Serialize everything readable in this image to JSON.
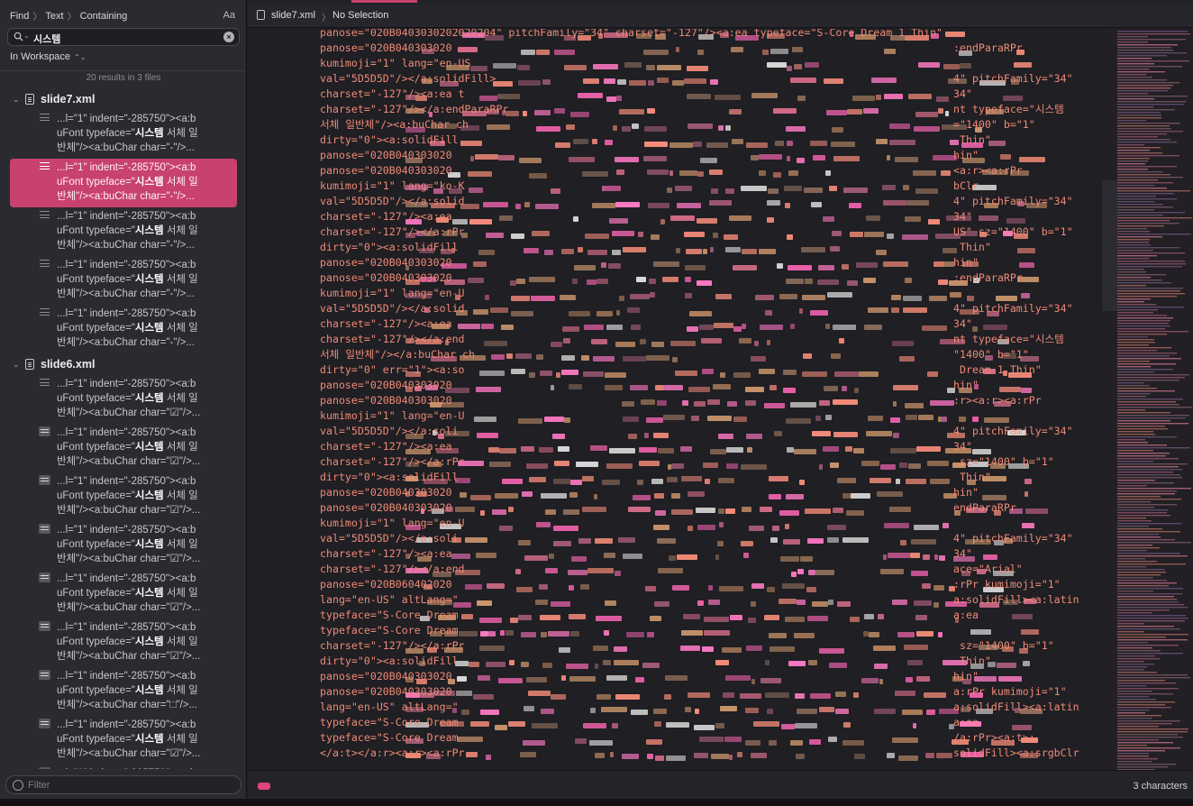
{
  "find": {
    "breadcrumb": [
      "Find",
      "Text",
      "Containing"
    ],
    "case_toggle": "Aa",
    "query": "시스템",
    "scope": "In Workspace",
    "summary": "20 results in 3 files",
    "filter_placeholder": "Filter"
  },
  "results": [
    {
      "file": "slide7.xml",
      "hits": [
        {
          "l1": "...l=\"1\" indent=\"-285750\"><a:b",
          "l2a": "uFont typeface=\"",
          "m": "시스템",
          "l2b": " 서체 일",
          "l3": "반체\"/><a:buChar char=\"-\"/>...",
          "icon": "lines"
        },
        {
          "l1": "...l=\"1\" indent=\"-285750\"><a:b",
          "l2a": "uFont typeface=\"",
          "m": "시스템",
          "l2b": " 서체 일",
          "l3": "반체\"/><a:buChar char=\"-\"/>...",
          "icon": "lines",
          "selected": true
        },
        {
          "l1": "...l=\"1\" indent=\"-285750\"><a:b",
          "l2a": "uFont typeface=\"",
          "m": "시스템",
          "l2b": " 서체 일",
          "l3": "반체\"/><a:buChar char=\"-\"/>...",
          "icon": "lines"
        },
        {
          "l1": "...l=\"1\" indent=\"-285750\"><a:b",
          "l2a": "uFont typeface=\"",
          "m": "시스템",
          "l2b": " 서체 일",
          "l3": "반체\"/><a:buChar char=\"-\"/>...",
          "icon": "lines"
        },
        {
          "l1": "...l=\"1\" indent=\"-285750\"><a:b",
          "l2a": "uFont typeface=\"",
          "m": "시스템",
          "l2b": " 서체 일",
          "l3": "반체\"/><a:buChar char=\"-\"/>...",
          "icon": "lines"
        }
      ]
    },
    {
      "file": "slide6.xml",
      "hits": [
        {
          "l1": "...l=\"1\" indent=\"-285750\"><a:b",
          "l2a": "uFont typeface=\"",
          "m": "시스템",
          "l2b": " 서체 일",
          "l3": "반체\"/><a:buChar char=\"☑\"/>...",
          "icon": "lines"
        },
        {
          "l1": "...l=\"1\" indent=\"-285750\"><a:b",
          "l2a": "uFont typeface=\"",
          "m": "시스템",
          "l2b": " 서체 일",
          "l3": "반체\"/><a:buChar char=\"☑\"/>...",
          "icon": "box"
        },
        {
          "l1": "...l=\"1\" indent=\"-285750\"><a:b",
          "l2a": "uFont typeface=\"",
          "m": "시스템",
          "l2b": " 서체 일",
          "l3": "반체\"/><a:buChar char=\"☑\"/>...",
          "icon": "box"
        },
        {
          "l1": "...l=\"1\" indent=\"-285750\"><a:b",
          "l2a": "uFont typeface=\"",
          "m": "시스템",
          "l2b": " 서체 일",
          "l3": "반체\"/><a:buChar char=\"☑\"/>...",
          "icon": "box"
        },
        {
          "l1": "...l=\"1\" indent=\"-285750\"><a:b",
          "l2a": "uFont typeface=\"",
          "m": "시스템",
          "l2b": " 서체 일",
          "l3": "반체\"/><a:buChar char=\"☑\"/>...",
          "icon": "box"
        },
        {
          "l1": "...l=\"1\" indent=\"-285750\"><a:b",
          "l2a": "uFont typeface=\"",
          "m": "시스템",
          "l2b": " 서체 일",
          "l3": "반체\"/><a:buChar char=\"☑\"/>...",
          "icon": "box"
        },
        {
          "l1": "...l=\"1\" indent=\"-285750\"><a:b",
          "l2a": "uFont typeface=\"",
          "m": "시스템",
          "l2b": " 서체 일",
          "l3": "반체\"/><a:buChar char=\"□\"/>...",
          "icon": "box"
        },
        {
          "l1": "...l=\"1\" indent=\"-285750\"><a:b",
          "l2a": "uFont typeface=\"",
          "m": "시스템",
          "l2b": " 서체 일",
          "l3": "반체\"/><a:buChar char=\"☑\"/>...",
          "icon": "box"
        },
        {
          "l1": "...l=\"1\" indent=\"-285750\"><a:b",
          "l2a": "",
          "m": "",
          "l2b": "",
          "l3": "",
          "icon": "box"
        }
      ]
    }
  ],
  "editor": {
    "filename": "slide7.xml",
    "selection": "No Selection",
    "status_right": "3 characters",
    "left_lines": [
      "panose=\"020B0403030202020204\" pitchFamily=\"34\" charset=\"-127\"/><a:ea typeface=\"S-Core Dream 1 Thin\"",
      "panose=\"020B040303020",
      "kumimoji=\"1\" lang=\"en-US",
      "val=\"5D5D5D\"/></a:solidFill>",
      "charset=\"-127\"/><a:ea t",
      "charset=\"-127\"/></a:endParaRPr",
      "서체 일반체\"/><a:buChar ch",
      "dirty=\"0\"><a:solidFill",
      "panose=\"020B040303020",
      "panose=\"020B040303020",
      "kumimoji=\"1\" lang=\"ko-K",
      "val=\"5D5D5D\"/></a:solid",
      "charset=\"-127\"/><a:ea",
      "charset=\"-127\"/></a:rPr",
      "dirty=\"0\"><a:solidFill",
      "panose=\"020B040303020",
      "panose=\"020B040303020",
      "kumimoji=\"1\" lang=\"en-U",
      "val=\"5D5D5D\"/></a:solid",
      "charset=\"-127\"/><a:ea",
      "charset=\"-127\"/></a:end",
      "서체 일반체\"/></a:buChar ch",
      "dirty=\"0\" err=\"1\"><a:so",
      "panose=\"020B040303020",
      "panose=\"020B040303020",
      "kumimoji=\"1\" lang=\"en-U",
      "val=\"5D5D5D\"/></a:soli",
      "charset=\"-127\"/><a:ea",
      "charset=\"-127\"/></a:rPr",
      "dirty=\"0\"><a:solidFill",
      "panose=\"020B040303020",
      "panose=\"020B040303020",
      "kumimoji=\"1\" lang=\"en-U",
      "val=\"5D5D5D\"/></a:soli",
      "charset=\"-127\"/><a:ea",
      "charset=\"-127\"/></a:end",
      "panose=\"020B060402020",
      "lang=\"en-US\" altLang=\"",
      "typeface=\"S-Core Dream",
      "typeface=\"S-Core Dream",
      "charset=\"-127\"/></a:rPr",
      "dirty=\"0\"><a:solidFill",
      "panose=\"020B040303020",
      "panose=\"020B040303020",
      "lang=\"en-US\" altLang=\"",
      "typeface=\"S-Core Dream",
      "typeface=\"S-Core Dream",
      "</a:t></a:r><a:r><a:rPr"
    ],
    "right_lines": [
      "",
      ":endParaRPr",
      "",
      "4\" pitchFamily=\"34\"",
      "34\"",
      "nt typeface=\"",
      "=\"1400\" b=\"1\"",
      " Thin\"",
      "hin\"",
      "<a:r><a:rPr",
      "bClr",
      "4\" pitchFamily=\"34\"",
      "34\"",
      "US\" sz=\"1400\" b=\"1\"",
      " Thin\"",
      "hin\"",
      ":endParaRPr",
      "",
      "4\" pitchFamily=\"34\"",
      "34\"",
      "nt typeface=\"",
      "\"1400\" b=\"1\"",
      " Dream 1 Thin\"",
      "hin\"",
      ":r><a:r><a:rPr",
      "",
      "4\" pitchFamily=\"34\"",
      "34\"",
      " sz=\"1400\" b=\"1\"",
      " Thin\"",
      "hin\"",
      "endParaRPr",
      "",
      "4\" pitchFamily=\"34\"",
      "34\"",
      "ace=\"Arial\"",
      ":rPr kumimoji=\"1\"",
      "a:solidFill><a:latin",
      "a:ea",
      "",
      " sz=\"1400\" b=\"1\"",
      " Thin\"",
      "hin\"",
      "a:rPr kumimoji=\"1\"",
      "a:solidFill><a:latin",
      "a:ea",
      "/a:rPr><a:t>:",
      "solidFill><a:srgbClr"
    ],
    "match_gray": "시스템",
    "match_yellow": "시스템"
  },
  "colors": {
    "accent": "#c8416f",
    "attr": "#f08a76",
    "match": "#e8e825",
    "sidebar_bg": "#2b2a30",
    "editor_bg": "#1f1f24"
  }
}
